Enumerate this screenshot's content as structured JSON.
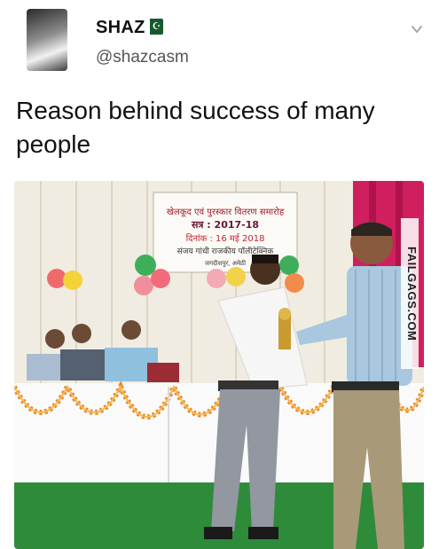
{
  "tweet": {
    "display_name": "SHAZ",
    "handle": "@shazcasm",
    "text": "Reason behind success of many people"
  },
  "banner": {
    "line1": "खेलकूद एवं पुरस्कार वितरण समारोह",
    "line2": "सत्र : 2017-18",
    "line3": "दिनांक : 16 मई 2018",
    "line4": "संजय गांधी राजकीय पॉलीटेक्निक",
    "line5": "जगदीशपुर, अमेठी"
  },
  "watermark": "FAILGAGS.COM",
  "colors": {
    "flag_green": "#155a2e",
    "handle_gray": "#555555",
    "stage_floor_green": "#2e8b3a",
    "curtain_pink": "#d01f5e"
  },
  "icons": {
    "chevron": "chevron-down-icon",
    "flag": "pakistan-flag-icon"
  }
}
